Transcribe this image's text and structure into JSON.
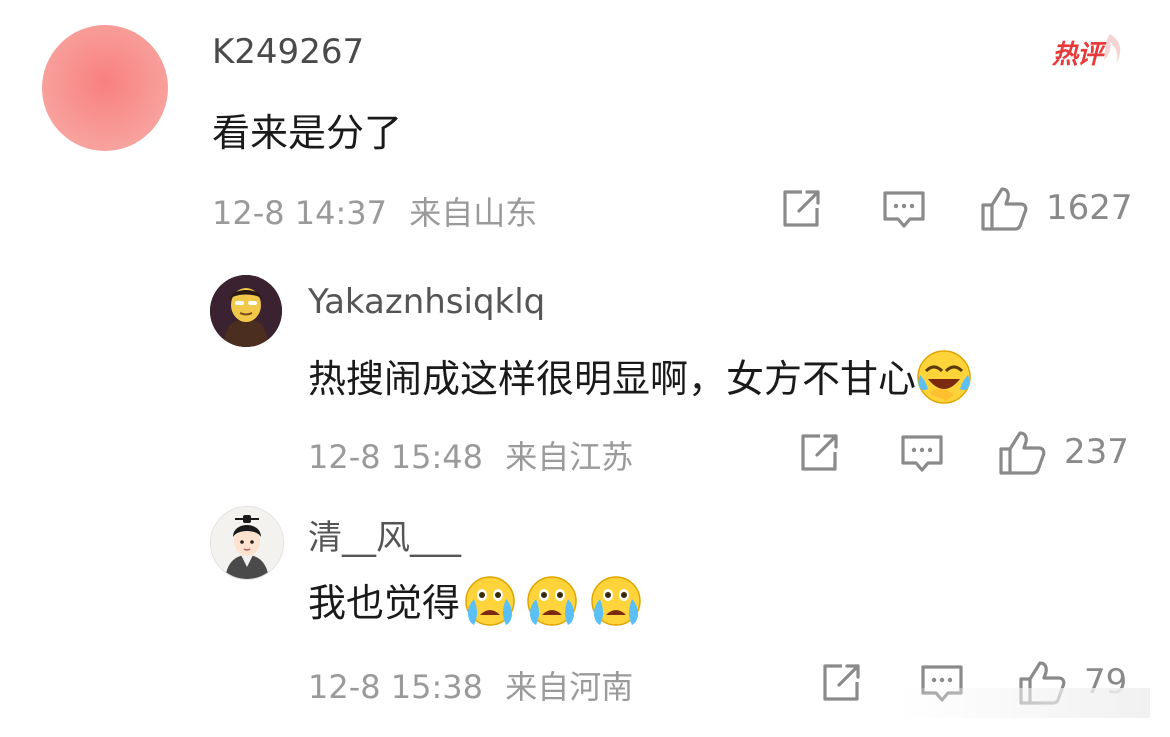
{
  "badge": {
    "hot_label": "热评"
  },
  "comment": {
    "username": "K249267",
    "text": "看来是分了",
    "timestamp": "12-8 14:37",
    "location": "来自山东",
    "likes": "1627"
  },
  "replies": [
    {
      "username": "Yakaznhsiqklq",
      "text": "热搜闹成这样很明显啊，女方不甘心",
      "emoji": "laugh-cry-emoji",
      "timestamp": "12-8 15:48",
      "location": "来自江苏",
      "likes": "237"
    },
    {
      "username": "清__风___",
      "text": "我也觉得",
      "emoji": "crying-emoji",
      "timestamp": "12-8 15:38",
      "location": "来自河南",
      "likes": "79"
    }
  ],
  "icons": {
    "share": "share-icon",
    "comment": "comment-icon",
    "like": "thumbs-up-icon"
  },
  "colors": {
    "hot_red": "#e83a3a",
    "meta_gray": "#9a9a9a",
    "text_dark": "#1a1a1a"
  }
}
